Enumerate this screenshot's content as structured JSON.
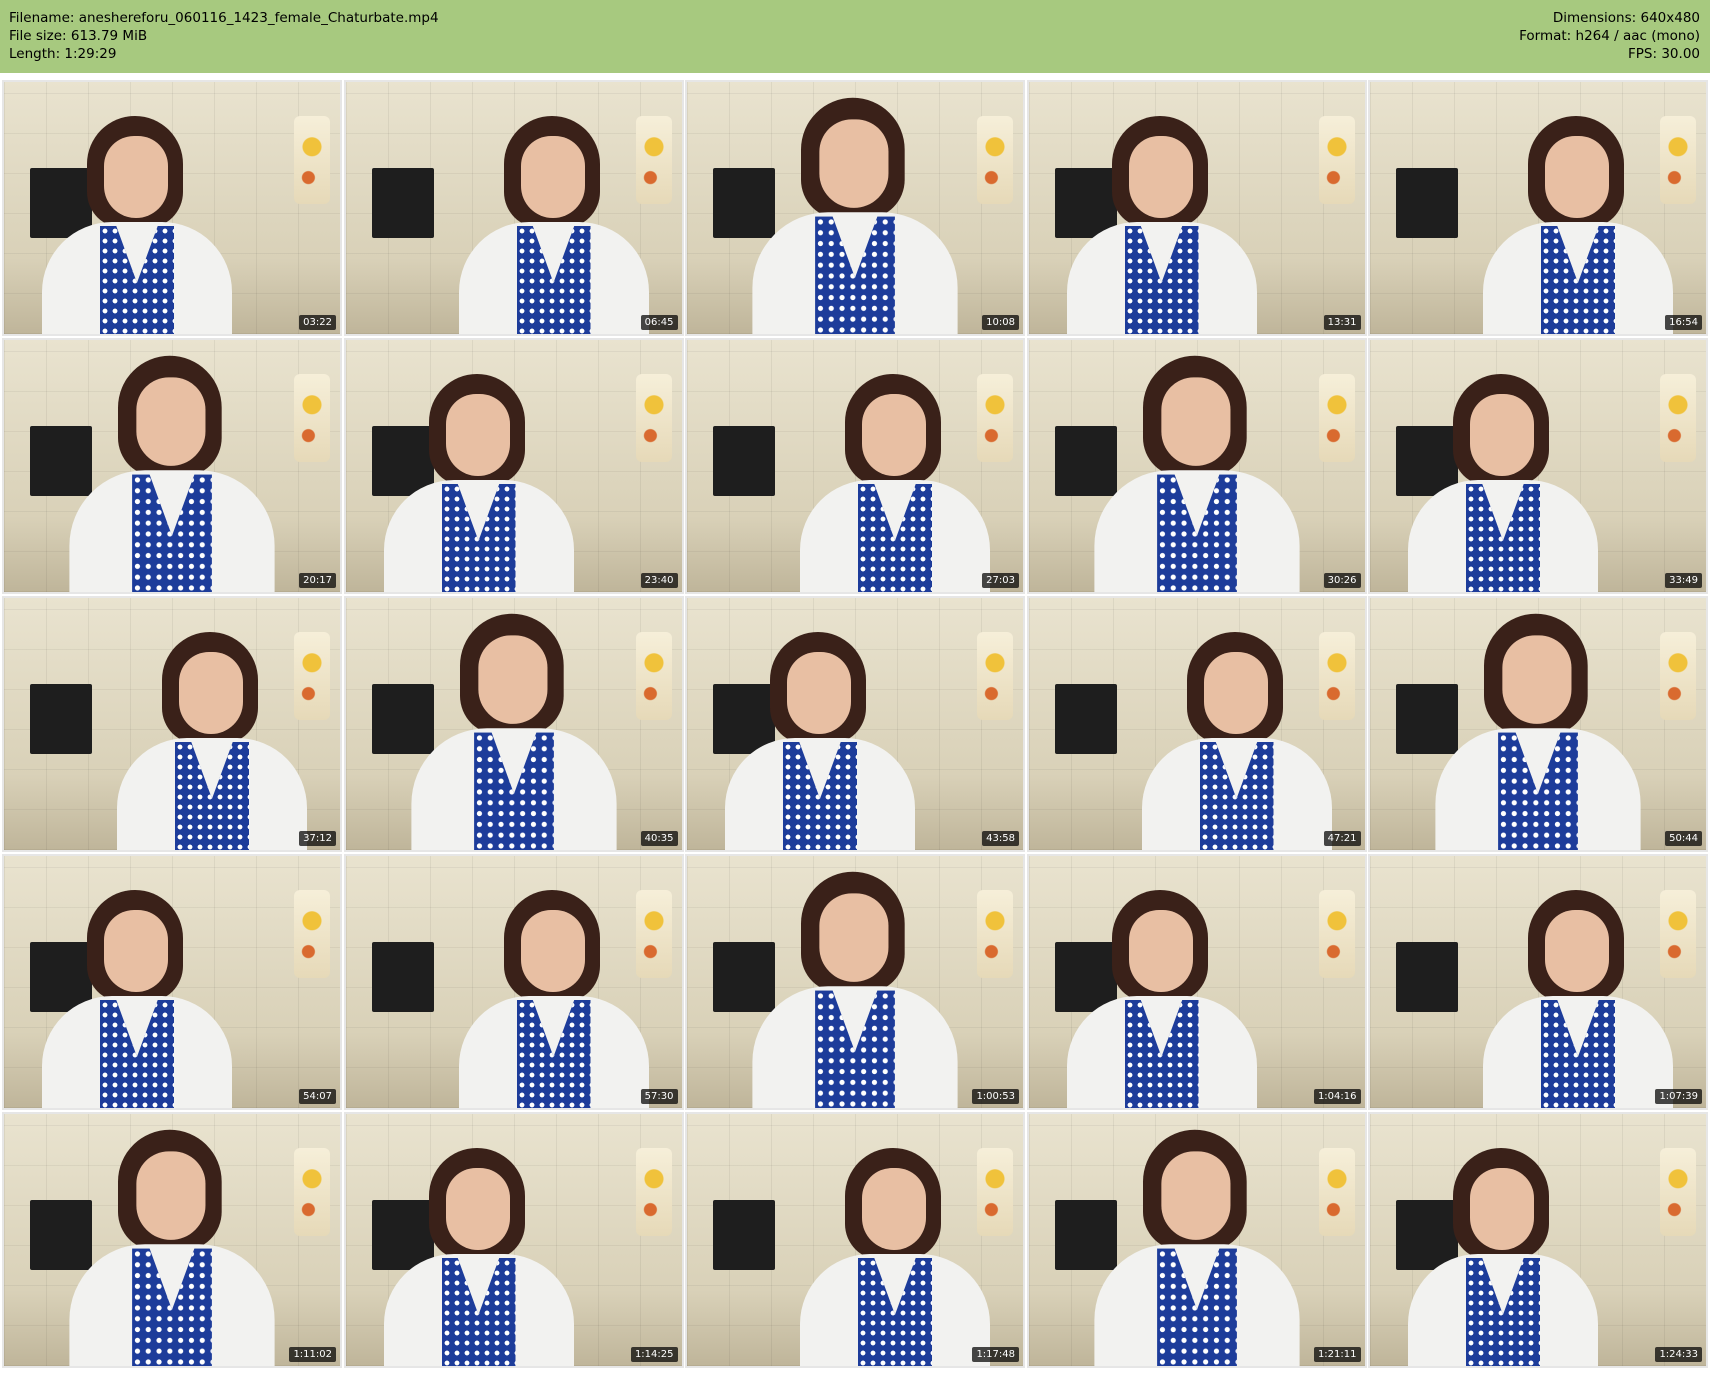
{
  "header": {
    "filename_line": "Filename: aneshereforu_060116_1423_female_Chaturbate.mp4",
    "filesize_line": "File size: 613.79 MiB",
    "length_line": "Length: 1:29:29",
    "dimensions_line": "Dimensions: 640x480",
    "format_line": "Format: h264 / aac (mono)",
    "fps_line": "FPS: 30.00"
  },
  "colors": {
    "header_background": "#a7c97f",
    "apron_blue": "#1d3c9a",
    "timestamp_background": "#000000"
  },
  "thumbnails": [
    {
      "timestamp": "03:22"
    },
    {
      "timestamp": "06:45"
    },
    {
      "timestamp": "10:08"
    },
    {
      "timestamp": "13:31"
    },
    {
      "timestamp": "16:54"
    },
    {
      "timestamp": "20:17"
    },
    {
      "timestamp": "23:40"
    },
    {
      "timestamp": "27:03"
    },
    {
      "timestamp": "30:26"
    },
    {
      "timestamp": "33:49"
    },
    {
      "timestamp": "37:12"
    },
    {
      "timestamp": "40:35"
    },
    {
      "timestamp": "43:58"
    },
    {
      "timestamp": "47:21"
    },
    {
      "timestamp": "50:44"
    },
    {
      "timestamp": "54:07"
    },
    {
      "timestamp": "57:30"
    },
    {
      "timestamp": "1:00:53"
    },
    {
      "timestamp": "1:04:16"
    },
    {
      "timestamp": "1:07:39"
    },
    {
      "timestamp": "1:11:02"
    },
    {
      "timestamp": "1:14:25"
    },
    {
      "timestamp": "1:17:48"
    },
    {
      "timestamp": "1:21:11"
    },
    {
      "timestamp": "1:24:33"
    }
  ]
}
